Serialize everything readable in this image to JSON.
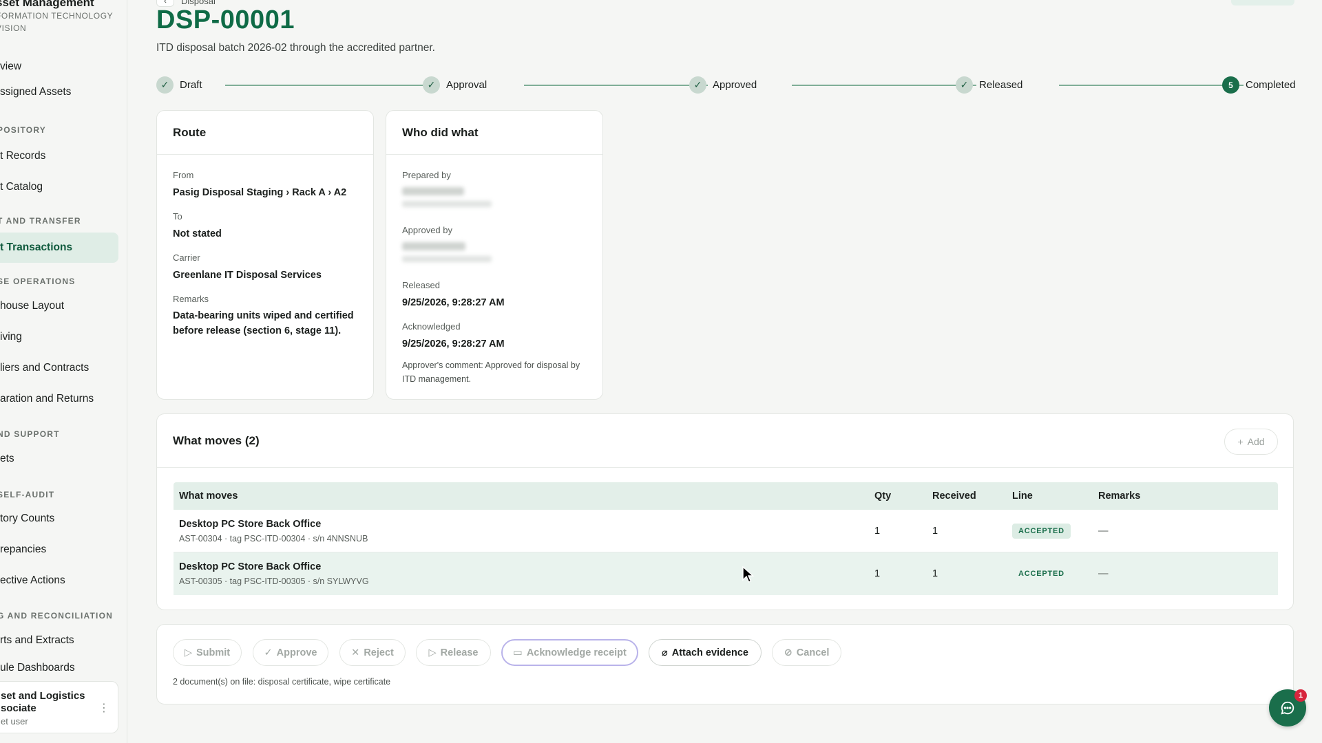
{
  "sidebar": {
    "brand_title": "sset Management",
    "brand_sub_1": "FORMATION TECHNOLOGY",
    "brand_sub_2": "VISION",
    "items": [
      {
        "label": "view"
      },
      {
        "label": "ssigned Assets"
      },
      {
        "section": "POSITORY"
      },
      {
        "label": "t Records"
      },
      {
        "label": "t Catalog"
      },
      {
        "section": "T AND TRANSFER"
      },
      {
        "label": "t Transactions"
      },
      {
        "section": "SE OPERATIONS"
      },
      {
        "label": "house Layout"
      },
      {
        "label": "iving"
      },
      {
        "label": "liers and Contracts"
      },
      {
        "label": "aration and Returns"
      },
      {
        "section": "ND SUPPORT"
      },
      {
        "label": "ets"
      },
      {
        "section": "SELF-AUDIT"
      },
      {
        "label": "tory Counts"
      },
      {
        "label": "repancies"
      },
      {
        "label": "ective Actions"
      },
      {
        "section": "G AND RECONCILIATION"
      },
      {
        "label": "rts and Extracts"
      },
      {
        "label": "ule Dashboards"
      }
    ],
    "user": {
      "name_1": "set and Logistics",
      "name_2": "sociate",
      "role": "et user"
    }
  },
  "header": {
    "breadcrumb": "Disposal",
    "title": "DSP-00001",
    "description": "ITD disposal batch 2026-02 through the accredited partner."
  },
  "stepper": {
    "steps": [
      {
        "label": "Draft",
        "state": "done"
      },
      {
        "label": "Approval",
        "state": "done"
      },
      {
        "label": "Approved",
        "state": "done"
      },
      {
        "label": "Released",
        "state": "done"
      },
      {
        "label": "Completed",
        "state": "current",
        "number": "5"
      }
    ]
  },
  "route": {
    "title": "Route",
    "from_label": "From",
    "from_value": "Pasig Disposal Staging › Rack A › A2",
    "to_label": "To",
    "to_value": "Not stated",
    "carrier_label": "Carrier",
    "carrier_value": "Greenlane IT Disposal Services",
    "remarks_label": "Remarks",
    "remarks_value_1": "Data-bearing units wiped and certified",
    "remarks_value_2": "before release (section 6, stage 11)."
  },
  "who": {
    "title": "Who did what",
    "prepared_label": "Prepared by",
    "approved_label": "Approved by",
    "released_label": "Released",
    "released_value": "9/25/2026, 9:28:27 AM",
    "ack_label": "Acknowledged",
    "ack_value": "9/25/2026, 9:28:27 AM",
    "comment_1": "Approver's comment: Approved for disposal by",
    "comment_2": "ITD management."
  },
  "moves": {
    "title": "What moves (2)",
    "add_label": "Add",
    "columns": [
      "What moves",
      "Qty",
      "Received",
      "Line",
      "Remarks"
    ],
    "rows": [
      {
        "name": "Desktop PC Store Back Office",
        "sub": "AST-00304 · tag PSC-ITD-00304 · s/n 4NNSNUB",
        "qty": "1",
        "received": "1",
        "line": "ACCEPTED",
        "remarks": "—"
      },
      {
        "name": "Desktop PC Store Back Office",
        "sub": "AST-00305 · tag PSC-ITD-00305 · s/n SYLWYVG",
        "qty": "1",
        "received": "1",
        "line": "ACCEPTED",
        "remarks": "—"
      }
    ]
  },
  "actions": {
    "submit": "Submit",
    "approve": "Approve",
    "reject": "Reject",
    "release": "Release",
    "acknowledge": "Acknowledge receipt",
    "attach": "Attach evidence",
    "cancel": "Cancel",
    "docs_note": "2 document(s) on file: disposal certificate, wipe certificate"
  },
  "chat": {
    "badge": "1"
  },
  "colors": {
    "accent": "#1a6e4b",
    "title": "#0f6b46",
    "badge_bg": "#dcece4"
  }
}
